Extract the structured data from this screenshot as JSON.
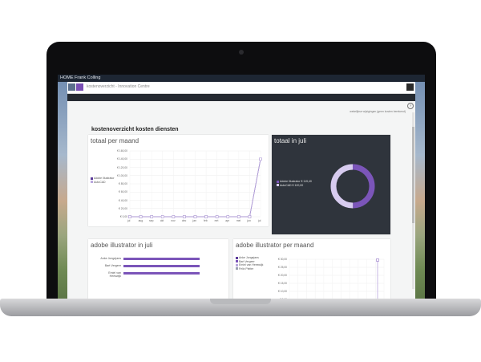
{
  "topbar": {
    "brand": "HOME  Frank Colling"
  },
  "appbar": {
    "breadcrumb": "kostenoverzicht - Innovation Centre"
  },
  "header": {
    "subtext": "wekelijkse wijzigingen (geen kosten berekend)",
    "help": "?"
  },
  "page": {
    "title": "kostenoverzicht kosten diensten"
  },
  "cards": {
    "totaal_per_maand": {
      "title": "totaal per maand",
      "legend": [
        {
          "label": "Adobe Illustrator",
          "color": "#5b3a9a"
        },
        {
          "label": "AutoCAD",
          "color": "#b9a6de"
        }
      ]
    },
    "totaal_in_juli": {
      "title": "totaal in juli",
      "legend": [
        {
          "label": "Adobe Illustrator € 119,40",
          "color": "#7b55b9"
        },
        {
          "label": "AutoCAD € 120,00",
          "color": "#d7cbef"
        }
      ]
    },
    "illustrator_in_juli": {
      "title": "adobe illustrator in juli",
      "rows": [
        {
          "label": "Anke Jongejans",
          "value": 19.9
        },
        {
          "label": "Bart Vergeer",
          "value": 19.9
        },
        {
          "label": "Emiel van Heeswijk",
          "value": 19.9
        }
      ]
    },
    "illustrator_per_maand": {
      "title": "adobe illustrator per maand",
      "legend": [
        {
          "label": "Anke Jongejans",
          "color": "#5b3a9a"
        },
        {
          "label": "Bart Vergeer",
          "color": "#7b55b9"
        },
        {
          "label": "Emiel van Heeswijk",
          "color": "#b9a6de"
        },
        {
          "label": "Felix Pleiter",
          "color": "#9aa0b0"
        }
      ]
    }
  },
  "chart_data": [
    {
      "type": "line",
      "title": "totaal per maand",
      "categories": [
        "jul",
        "aug",
        "sep",
        "okt",
        "nov",
        "dec",
        "jan",
        "feb",
        "mrt",
        "apr",
        "mei",
        "jun",
        "jul"
      ],
      "series": [
        {
          "name": "Adobe Illustrator",
          "values": [
            0,
            0,
            0,
            0,
            0,
            0,
            0,
            0,
            0,
            0,
            0,
            0,
            140
          ]
        },
        {
          "name": "AutoCAD",
          "values": [
            0,
            0,
            0,
            0,
            0,
            0,
            0,
            0,
            0,
            0,
            0,
            0,
            140
          ]
        }
      ],
      "yticks": [
        "€ 0,00",
        "€ 20,00",
        "€ 40,00",
        "€ 60,00",
        "€ 80,00",
        "€ 100,00",
        "€ 120,00",
        "€ 140,00",
        "€ 160,00"
      ],
      "ylim": [
        0,
        160
      ]
    },
    {
      "type": "pie",
      "title": "totaal in juli",
      "labels": [
        "Adobe Illustrator",
        "AutoCAD"
      ],
      "values": [
        119.4,
        120.0
      ]
    },
    {
      "type": "bar",
      "title": "adobe illustrator in juli",
      "categories": [
        "Anke Jongejans",
        "Bart Vergeer",
        "Emiel van Heeswijk"
      ],
      "values": [
        19.9,
        19.9,
        19.9
      ]
    },
    {
      "type": "line",
      "title": "adobe illustrator per maand",
      "yticks": [
        "€ 30,00",
        "€ 25,00",
        "€ 20,00",
        "€ 15,00",
        "€ 10,00",
        "€ 5,00"
      ],
      "ylim": [
        0,
        30
      ]
    }
  ]
}
